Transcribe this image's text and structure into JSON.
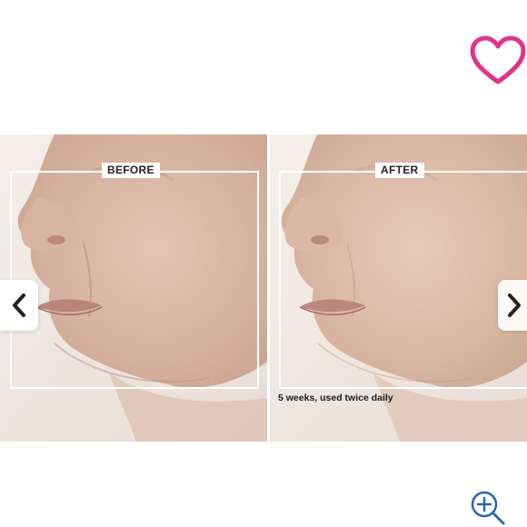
{
  "gallery": {
    "before_label": "BEFORE",
    "after_label": "AFTER",
    "caption": "5 weeks, used twice daily"
  },
  "icons": {
    "favorite": "heart-outline-icon",
    "previous": "chevron-left-icon",
    "next": "chevron-right-icon",
    "zoom": "zoom-in-icon"
  },
  "colors": {
    "heart": "#e0348a",
    "zoom": "#2b67b3",
    "arrow": "#222222",
    "skin": "#d9b8a6",
    "background": "#efe7e2"
  }
}
